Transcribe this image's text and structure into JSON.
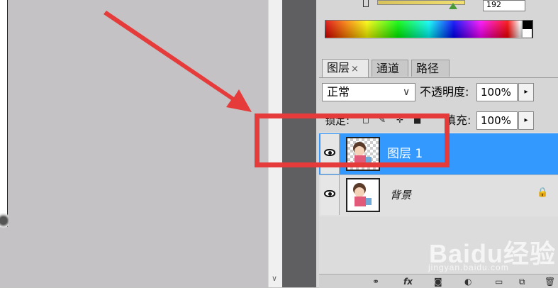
{
  "color_panel": {
    "value_text": "192"
  },
  "tabs": [
    {
      "label": "图层",
      "close": "×"
    },
    {
      "label": "通道"
    },
    {
      "label": "路径"
    }
  ],
  "blend": {
    "mode": "正常",
    "opacity_label": "不透明度:",
    "opacity_value": "100%",
    "arrow": "▸"
  },
  "lock": {
    "label": "锁定:",
    "fill_label": "填充:",
    "fill_value": "100%",
    "arrow": "▸"
  },
  "layers": [
    {
      "name": "图层 1",
      "selected": true,
      "visible": true
    },
    {
      "name": "背景",
      "selected": false,
      "visible": true,
      "locked": true
    }
  ],
  "footer_icons": [
    "link-icon",
    "fx-icon",
    "mask-icon",
    "adjustment-icon",
    "group-icon",
    "new-layer-icon",
    "delete-icon"
  ],
  "footer_glyphs": {
    "link": "⚭",
    "fx": "fx",
    "mask": "◙",
    "adjust": "◐",
    "group": "▭",
    "new": "⧉",
    "trash": "🗑"
  },
  "annotation": {
    "arrow_color": "#e53b3b",
    "box_color": "#e53b3b"
  },
  "watermark": {
    "brand": "Baidu经验",
    "url": "jingyan.baidu.com"
  },
  "colors": {
    "selected_row": "#3399ff",
    "canvas_bg": "#c4c2c4",
    "gutter": "#5f5f62"
  }
}
